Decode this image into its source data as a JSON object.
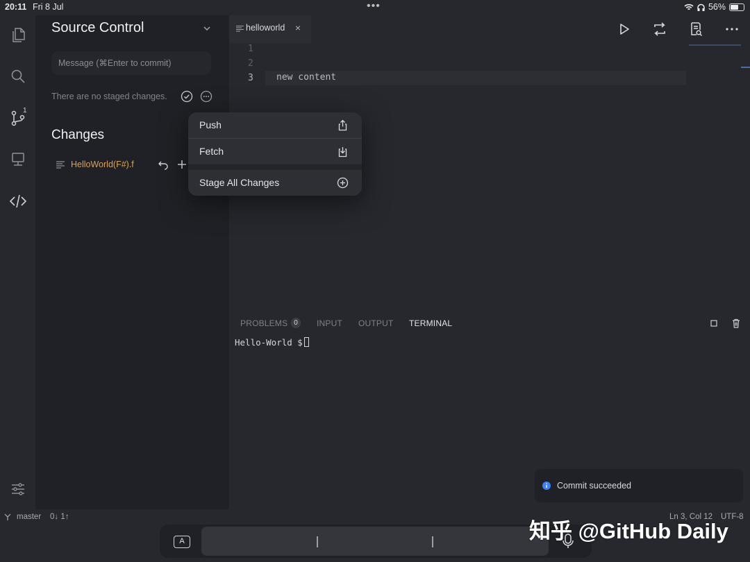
{
  "status_bar": {
    "time": "20:11",
    "date": "Fri 8 Jul",
    "battery": "56%"
  },
  "activity_bar": {
    "scm_badge": "1"
  },
  "sidebar": {
    "title": "Source Control",
    "commit_placeholder": "Message (⌘Enter to commit)",
    "no_staged": "There are no staged changes.",
    "changes_title": "Changes",
    "files": [
      {
        "name": "HelloWorld(F#).f"
      }
    ]
  },
  "editor": {
    "tab_label": "helloworld",
    "line_numbers": [
      "1",
      "2",
      "3"
    ],
    "code_line_3": "new content"
  },
  "panel": {
    "tabs": [
      "PROBLEMS",
      "INPUT",
      "OUTPUT",
      "TERMINAL"
    ],
    "problems_count": "0",
    "active_tab": "TERMINAL",
    "terminal_prompt": "Hello-World $"
  },
  "context_menu": {
    "items": [
      {
        "label": "Push",
        "icon": "share-icon"
      },
      {
        "label": "Fetch",
        "icon": "download-icon"
      },
      {
        "label": "Stage All Changes",
        "icon": "plus-circle-icon"
      }
    ]
  },
  "toast": {
    "message": "Commit succeeded"
  },
  "status_footer": {
    "branch": "master",
    "sync": "0↓ 1↑",
    "position": "Ln 3, Col 12",
    "encoding": "UTF-8"
  },
  "keyboard_bar": {
    "key_label": "A"
  },
  "watermark": "知乎 @GitHub Daily",
  "colors": {
    "background": "#26282e",
    "sidebar": "#1f2126",
    "modified_file": "#d9a35a",
    "info_blue": "#3b82f6"
  }
}
